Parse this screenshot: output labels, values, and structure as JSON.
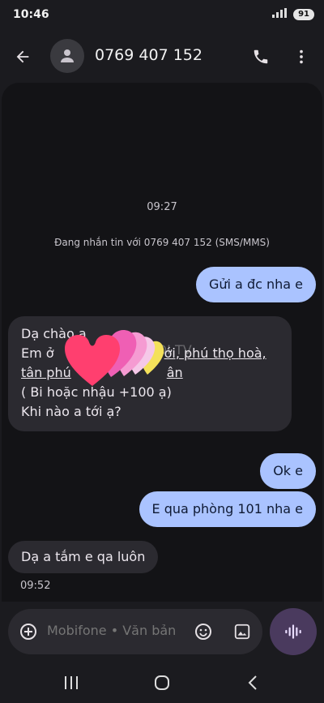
{
  "status_bar": {
    "time": "10:46",
    "battery": "91"
  },
  "header": {
    "contact": "0769 407 152"
  },
  "conversation": {
    "timestamp_top": "09:27",
    "info": "Đang nhắn tin với 0769 407 152 (SMS/MMS)",
    "messages": [
      {
        "direction": "outgoing",
        "text": "Gửi a đc nha e"
      },
      {
        "direction": "incoming",
        "lines": [
          "Dạ chào a",
          "Em ở",
          "ới, phú thọ hoà,",
          "tân phú",
          "ân",
          "( Bi hoặc nhậu +100 ạ)",
          "Khi nào a tới ạ?"
        ]
      },
      {
        "direction": "outgoing",
        "text": "Ok e"
      },
      {
        "direction": "outgoing",
        "text": "E qua phòng 101 nha e"
      },
      {
        "direction": "incoming",
        "text": "Dạ a tắm e qa luôn"
      }
    ],
    "timestamp_bottom": "09:52",
    "watermark": "GAI GỌI TV"
  },
  "compose": {
    "placeholder": "Mobifone • Văn bản"
  },
  "icons": {
    "back": "arrow-left-icon",
    "avatar": "person-icon",
    "call": "phone-icon",
    "more": "more-vert-icon",
    "add": "add-circle-icon",
    "emoji": "emoji-icon",
    "gallery": "image-icon",
    "voice": "voice-wave-icon"
  },
  "colors": {
    "outgoing_bubble": "#aac3ff",
    "incoming_bubble": "#2b2a30",
    "background": "#131316"
  }
}
